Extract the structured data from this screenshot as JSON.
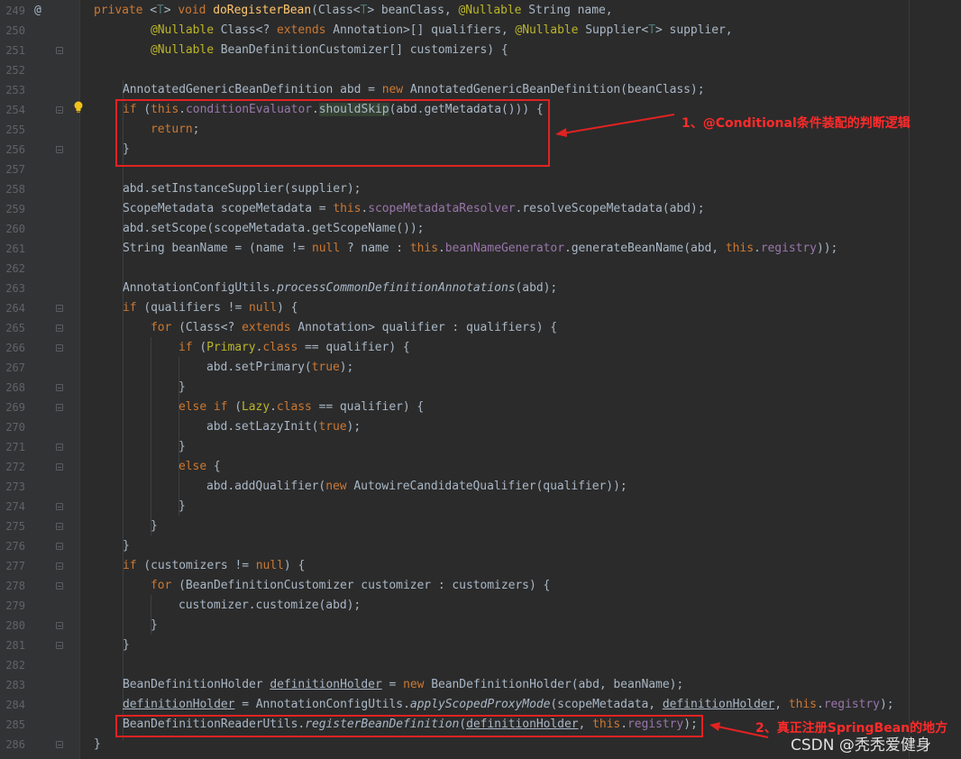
{
  "lines": [
    {
      "num": "249",
      "segs": [
        [
          "private ",
          "k"
        ],
        [
          "<",
          ""
        ],
        [
          "T",
          "tp"
        ],
        [
          "> ",
          ""
        ],
        [
          "void ",
          "k"
        ],
        [
          "doRegisterBean",
          "f"
        ],
        [
          "(Class<",
          ""
        ],
        [
          "T",
          "tp"
        ],
        [
          "> beanClass, ",
          ""
        ],
        [
          "@Nullable ",
          "a"
        ],
        [
          "String name,",
          ""
        ]
      ]
    },
    {
      "num": "250",
      "segs": [
        [
          "@Nullable ",
          "a"
        ],
        [
          "Class<? ",
          ""
        ],
        [
          "extends ",
          "k"
        ],
        [
          "Annotation>[] qualifiers, ",
          ""
        ],
        [
          "@Nullable ",
          "a"
        ],
        [
          "Supplier<",
          ""
        ],
        [
          "T",
          "tp"
        ],
        [
          "> supplier,",
          ""
        ]
      ]
    },
    {
      "num": "251",
      "segs": [
        [
          "@Nullable ",
          "a"
        ],
        [
          "BeanDefinitionCustomizer[] customizers) {",
          ""
        ]
      ]
    },
    {
      "num": "252",
      "segs": []
    },
    {
      "num": "253",
      "segs": [
        [
          "AnnotatedGenericBeanDefinition abd = ",
          ""
        ],
        [
          "new ",
          "k"
        ],
        [
          "AnnotatedGenericBeanDefinition(beanClass);",
          ""
        ]
      ]
    },
    {
      "num": "254",
      "segs": [
        [
          "if ",
          "k"
        ],
        [
          "(",
          ""
        ],
        [
          "this",
          "k"
        ],
        [
          ".",
          ""
        ],
        [
          "conditionEvaluator",
          "p"
        ],
        [
          ".",
          ""
        ],
        [
          "shouldSkip",
          "hl"
        ],
        [
          "(abd.getMetadata())) {",
          ""
        ]
      ]
    },
    {
      "num": "255",
      "segs": [
        [
          "return",
          "k"
        ],
        [
          ";",
          ""
        ]
      ]
    },
    {
      "num": "256",
      "segs": [
        [
          "}",
          ""
        ]
      ]
    },
    {
      "num": "257",
      "segs": []
    },
    {
      "num": "258",
      "segs": [
        [
          "abd.setInstanceSupplier(supplier);",
          ""
        ]
      ]
    },
    {
      "num": "259",
      "segs": [
        [
          "ScopeMetadata scopeMetadata = ",
          ""
        ],
        [
          "this",
          "k"
        ],
        [
          ".",
          ""
        ],
        [
          "scopeMetadataResolver",
          "p"
        ],
        [
          ".resolveScopeMetadata(abd);",
          ""
        ]
      ]
    },
    {
      "num": "260",
      "segs": [
        [
          "abd.setScope(scopeMetadata.getScopeName());",
          ""
        ]
      ]
    },
    {
      "num": "261",
      "segs": [
        [
          "String beanName = (name != ",
          ""
        ],
        [
          "null ",
          "k"
        ],
        [
          "? name : ",
          ""
        ],
        [
          "this",
          "k"
        ],
        [
          ".",
          ""
        ],
        [
          "beanNameGenerator",
          "p"
        ],
        [
          ".generateBeanName(abd, ",
          ""
        ],
        [
          "this",
          "k"
        ],
        [
          ".",
          ""
        ],
        [
          "registry",
          "p"
        ],
        [
          "));",
          ""
        ]
      ]
    },
    {
      "num": "262",
      "segs": []
    },
    {
      "num": "263",
      "segs": [
        [
          "AnnotationConfigUtils.",
          ""
        ],
        [
          "processCommonDefinitionAnnotations",
          "i"
        ],
        [
          "(abd);",
          ""
        ]
      ]
    },
    {
      "num": "264",
      "segs": [
        [
          "if ",
          "k"
        ],
        [
          "(qualifiers != ",
          ""
        ],
        [
          "null",
          "k"
        ],
        [
          ") {",
          ""
        ]
      ]
    },
    {
      "num": "265",
      "segs": [
        [
          "for ",
          "k"
        ],
        [
          "(Class<? ",
          ""
        ],
        [
          "extends ",
          "k"
        ],
        [
          "Annotation> qualifier : qualifiers) {",
          ""
        ]
      ]
    },
    {
      "num": "266",
      "segs": [
        [
          "if ",
          "k"
        ],
        [
          "(",
          ""
        ],
        [
          "Primary",
          "a"
        ],
        [
          ".",
          ""
        ],
        [
          "class ",
          "k"
        ],
        [
          "== qualifier) {",
          ""
        ]
      ]
    },
    {
      "num": "267",
      "segs": [
        [
          "abd.setPrimary(",
          ""
        ],
        [
          "true",
          "k"
        ],
        [
          ");",
          ""
        ]
      ]
    },
    {
      "num": "268",
      "segs": [
        [
          "}",
          ""
        ]
      ]
    },
    {
      "num": "269",
      "segs": [
        [
          "else if ",
          "k"
        ],
        [
          "(",
          ""
        ],
        [
          "Lazy",
          "a"
        ],
        [
          ".",
          ""
        ],
        [
          "class ",
          "k"
        ],
        [
          "== qualifier) {",
          ""
        ]
      ]
    },
    {
      "num": "270",
      "segs": [
        [
          "abd.setLazyInit(",
          ""
        ],
        [
          "true",
          "k"
        ],
        [
          ");",
          ""
        ]
      ]
    },
    {
      "num": "271",
      "segs": [
        [
          "}",
          ""
        ]
      ]
    },
    {
      "num": "272",
      "segs": [
        [
          "else ",
          "k"
        ],
        [
          "{",
          ""
        ]
      ]
    },
    {
      "num": "273",
      "segs": [
        [
          "abd.addQualifier(",
          ""
        ],
        [
          "new ",
          "k"
        ],
        [
          "AutowireCandidateQualifier(qualifier));",
          ""
        ]
      ]
    },
    {
      "num": "274",
      "segs": [
        [
          "}",
          ""
        ]
      ]
    },
    {
      "num": "275",
      "segs": [
        [
          "}",
          ""
        ]
      ]
    },
    {
      "num": "276",
      "segs": [
        [
          "}",
          ""
        ]
      ]
    },
    {
      "num": "277",
      "segs": [
        [
          "if ",
          "k"
        ],
        [
          "(customizers != ",
          ""
        ],
        [
          "null",
          "k"
        ],
        [
          ") {",
          ""
        ]
      ]
    },
    {
      "num": "278",
      "segs": [
        [
          "for ",
          "k"
        ],
        [
          "(BeanDefinitionCustomizer customizer : customizers) {",
          ""
        ]
      ]
    },
    {
      "num": "279",
      "segs": [
        [
          "customizer.customize(abd);",
          ""
        ]
      ]
    },
    {
      "num": "280",
      "segs": [
        [
          "}",
          ""
        ]
      ]
    },
    {
      "num": "281",
      "segs": [
        [
          "}",
          ""
        ]
      ]
    },
    {
      "num": "282",
      "segs": []
    },
    {
      "num": "283",
      "segs": [
        [
          "BeanDefinitionHolder ",
          ""
        ],
        [
          "definitionHolder",
          "u"
        ],
        [
          " = ",
          ""
        ],
        [
          "new ",
          "k"
        ],
        [
          "BeanDefinitionHolder(abd, beanName);",
          ""
        ]
      ]
    },
    {
      "num": "284",
      "segs": [
        [
          "definitionHolder",
          "u"
        ],
        [
          " = AnnotationConfigUtils.",
          ""
        ],
        [
          "applyScopedProxyMode",
          "i"
        ],
        [
          "(scopeMetadata, ",
          ""
        ],
        [
          "definitionHolder",
          "u"
        ],
        [
          ", ",
          ""
        ],
        [
          "this",
          "k"
        ],
        [
          ".",
          ""
        ],
        [
          "registry",
          "p"
        ],
        [
          ");",
          ""
        ]
      ]
    },
    {
      "num": "285",
      "segs": [
        [
          "BeanDefinitionReaderUtils.",
          ""
        ],
        [
          "registerBeanDefinition",
          "i"
        ],
        [
          "(",
          ""
        ],
        [
          "definitionHolder",
          "u"
        ],
        [
          ", ",
          ""
        ],
        [
          "this",
          "k"
        ],
        [
          ".",
          ""
        ],
        [
          "registry",
          "p"
        ],
        [
          ");",
          ""
        ]
      ]
    },
    {
      "num": "286",
      "segs": [
        [
          "}",
          ""
        ]
      ]
    }
  ],
  "annotations": {
    "note1": "1、@Conditional条件装配的判断逻辑",
    "note2": "2、真正注册SpringBean的地方"
  },
  "override_marker": "@",
  "watermark": "CSDN @秃秃爱健身",
  "colors": {
    "annotation": "#e22222",
    "keyword": "#cc7832",
    "method": "#ffc66d",
    "field": "#9876aa"
  }
}
